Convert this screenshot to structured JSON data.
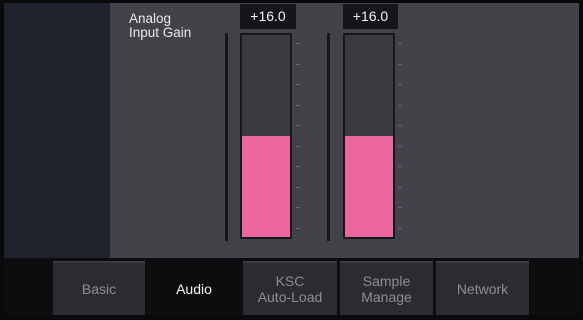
{
  "section": {
    "title_line1": "Analog",
    "title_line2": "Input Gain"
  },
  "meters": [
    {
      "readout": "+16.0",
      "level": 0.5
    },
    {
      "readout": "+16.0",
      "level": 0.5
    }
  ],
  "tabs": [
    {
      "label": "Basic",
      "active": false
    },
    {
      "label": "Audio",
      "active": true
    },
    {
      "label": "KSC\nAuto-Load",
      "active": false
    },
    {
      "label": "Sample\nManage",
      "active": false
    },
    {
      "label": "Network",
      "active": false
    }
  ],
  "colors": {
    "meter_fill": "#ec679f",
    "panel_bg": "#424349",
    "sidebar_bg": "#20222d"
  }
}
